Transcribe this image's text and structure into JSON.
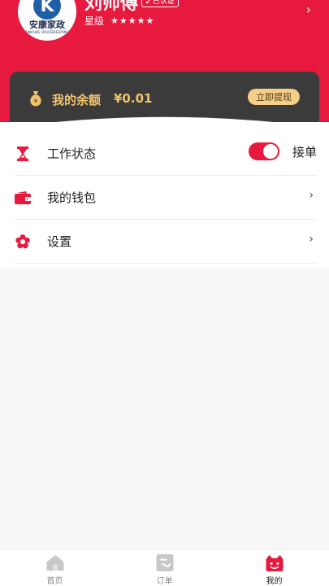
{
  "colors": {
    "brand": "#e8193f",
    "card": "#3b3b3b",
    "gold": "#f3c36b"
  },
  "profile": {
    "logo_cn": "安康家政",
    "logo_en": "ANKANG HOUSEKEEPING",
    "name": "刘师傅",
    "verified": "已认证",
    "star_label": "星级",
    "stars": "★★★★★",
    "chevron": "›"
  },
  "balance": {
    "label": "我的余额",
    "value": "¥0.01",
    "withdraw": "立即提现"
  },
  "menu": {
    "work_status": {
      "label": "工作状态",
      "toggle_label": "接单",
      "toggle_on": true,
      "icon": "hourglass-icon"
    },
    "wallet": {
      "label": "我的钱包",
      "icon": "wallet-icon",
      "chevron": "›"
    },
    "settings": {
      "label": "设置",
      "icon": "gear-icon",
      "chevron": "›"
    }
  },
  "tabs": [
    {
      "label": "首页",
      "icon": "home-icon",
      "active": false
    },
    {
      "label": "订单",
      "icon": "order-icon",
      "active": false
    },
    {
      "label": "我的",
      "icon": "profile-icon",
      "active": true
    }
  ]
}
